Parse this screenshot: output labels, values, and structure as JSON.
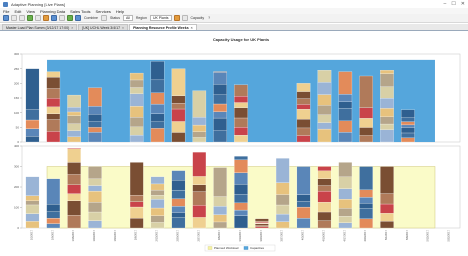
{
  "window": {
    "title": "Adaptive Planning [Live Plans]",
    "controls": [
      "–",
      "☐",
      "✕"
    ]
  },
  "menu": [
    "File",
    "Edit",
    "View",
    "Planning Data",
    "Sales Tools",
    "Services",
    "Help"
  ],
  "toolbar": {
    "combine_label": "Combine",
    "status_label": "Status",
    "status_value": "All",
    "region_label": "Region",
    "region_value": "UK Plants",
    "capacity_label": "Capacity",
    "help_label": "?"
  },
  "tabs": [
    {
      "label": "Master Load Plan Summ (3/12/17 17:00)",
      "active": false
    },
    {
      "label": "[UK] UCHL Week 3/4/17",
      "active": false
    },
    {
      "label": "Planning Resource Profile Weeks",
      "active": true
    }
  ],
  "colors": {
    "capacity_fill": "#f5f3a3",
    "capacity_stroke": "#d7d08a",
    "upper_bg": "#55a6dc",
    "upper_band": "#6cb6e8",
    "lower_bg": "#fafbc8"
  },
  "chart_data": [
    {
      "type": "bar",
      "stacked": true,
      "title": "Capacity Usage for UK Plants",
      "ylim": [
        0,
        300
      ],
      "yticks": [
        0,
        50,
        100,
        150,
        200,
        250,
        300
      ],
      "capacity_value": 280,
      "categories": [
        "1/2/2017",
        "1/9/2017",
        "1/16/2017",
        "1/23/2017",
        "1/30/2017",
        "2/6/2017",
        "2/13/2017",
        "2/20/2017",
        "2/27/2017",
        "3/6/2017",
        "3/13/2017",
        "3/20/2017",
        "3/27/2017",
        "4/3/2017",
        "4/10/2017",
        "4/17/2017",
        "4/24/2017",
        "5/1/2017",
        "5/8/2017",
        "5/15/2017",
        "5/22/2017"
      ],
      "totals": [
        250,
        240,
        160,
        185,
        0,
        235,
        275,
        250,
        175,
        240,
        195,
        0,
        0,
        200,
        245,
        240,
        225,
        245,
        110,
        0,
        0
      ]
    },
    {
      "type": "bar",
      "stacked": true,
      "ylim": [
        0,
        400
      ],
      "yticks": [
        0,
        100,
        200,
        300,
        400
      ],
      "capacity_value": 300,
      "categories": [
        "1/2/2017",
        "1/9/2017",
        "1/16/2017",
        "1/23/2017",
        "1/30/2017",
        "2/6/2017",
        "2/13/2017",
        "2/20/2017",
        "2/27/2017",
        "3/6/2017",
        "3/13/2017",
        "3/20/2017",
        "3/27/2017",
        "4/3/2017",
        "4/10/2017",
        "4/17/2017",
        "4/24/2017",
        "5/1/2017",
        "5/8/2017",
        "5/15/2017",
        "5/22/2017"
      ],
      "totals": [
        250,
        240,
        390,
        300,
        0,
        320,
        250,
        280,
        370,
        295,
        350,
        45,
        340,
        300,
        300,
        320,
        300,
        300,
        0,
        0,
        0
      ],
      "legend": [
        "Planned Workload",
        "Capacities"
      ]
    }
  ]
}
